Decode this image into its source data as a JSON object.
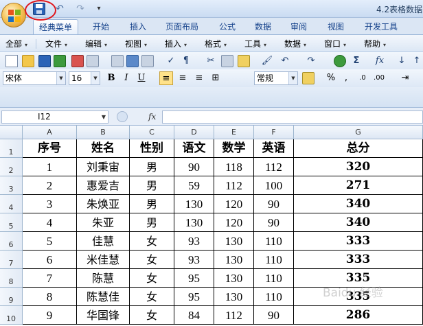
{
  "window": {
    "title": "4.2表格数据"
  },
  "ribbon_tabs": [
    "经典菜单",
    "开始",
    "插入",
    "页面布局",
    "公式",
    "数据",
    "审阅",
    "视图",
    "开发工具"
  ],
  "menus": [
    "全部",
    "文件",
    "编辑",
    "视图",
    "插入",
    "格式",
    "工具",
    "数据",
    "窗口",
    "帮助"
  ],
  "format_bar": {
    "font": "宋体",
    "size": "16",
    "bold": "B",
    "italic": "I",
    "underline": "U",
    "style": "常规",
    "percent": "%",
    "comma": ",",
    "sigma": "Σ",
    "fx": "fx"
  },
  "formula_bar": {
    "name_box": "I12",
    "fx_label": "fx",
    "value": ""
  },
  "columns": [
    "A",
    "B",
    "C",
    "D",
    "E",
    "F",
    "G"
  ],
  "rows": [
    "1",
    "2",
    "3",
    "4",
    "5",
    "6",
    "7",
    "8",
    "9",
    "10"
  ],
  "table": {
    "headers": [
      "序号",
      "姓名",
      "性别",
      "语文",
      "数学",
      "英语",
      "总分"
    ],
    "data": [
      [
        "1",
        "刘秉宙",
        "男",
        "90",
        "118",
        "112",
        "320"
      ],
      [
        "2",
        "惠爱吉",
        "男",
        "59",
        "112",
        "100",
        "271"
      ],
      [
        "3",
        "朱焕亚",
        "男",
        "130",
        "120",
        "90",
        "340"
      ],
      [
        "4",
        "朱亚",
        "男",
        "130",
        "120",
        "90",
        "340"
      ],
      [
        "5",
        "佳慧",
        "女",
        "93",
        "130",
        "110",
        "333"
      ],
      [
        "6",
        "米佳慧",
        "女",
        "93",
        "130",
        "110",
        "333"
      ],
      [
        "7",
        "陈慧",
        "女",
        "95",
        "130",
        "110",
        "335"
      ],
      [
        "8",
        "陈慧佳",
        "女",
        "95",
        "130",
        "110",
        "335"
      ],
      [
        "9",
        "华国锋",
        "女",
        "84",
        "112",
        "90",
        "286"
      ]
    ]
  },
  "watermark": "Baidu 经验",
  "colors": {
    "annotation": "#e0161c",
    "ribbon_text": "#15428b"
  }
}
